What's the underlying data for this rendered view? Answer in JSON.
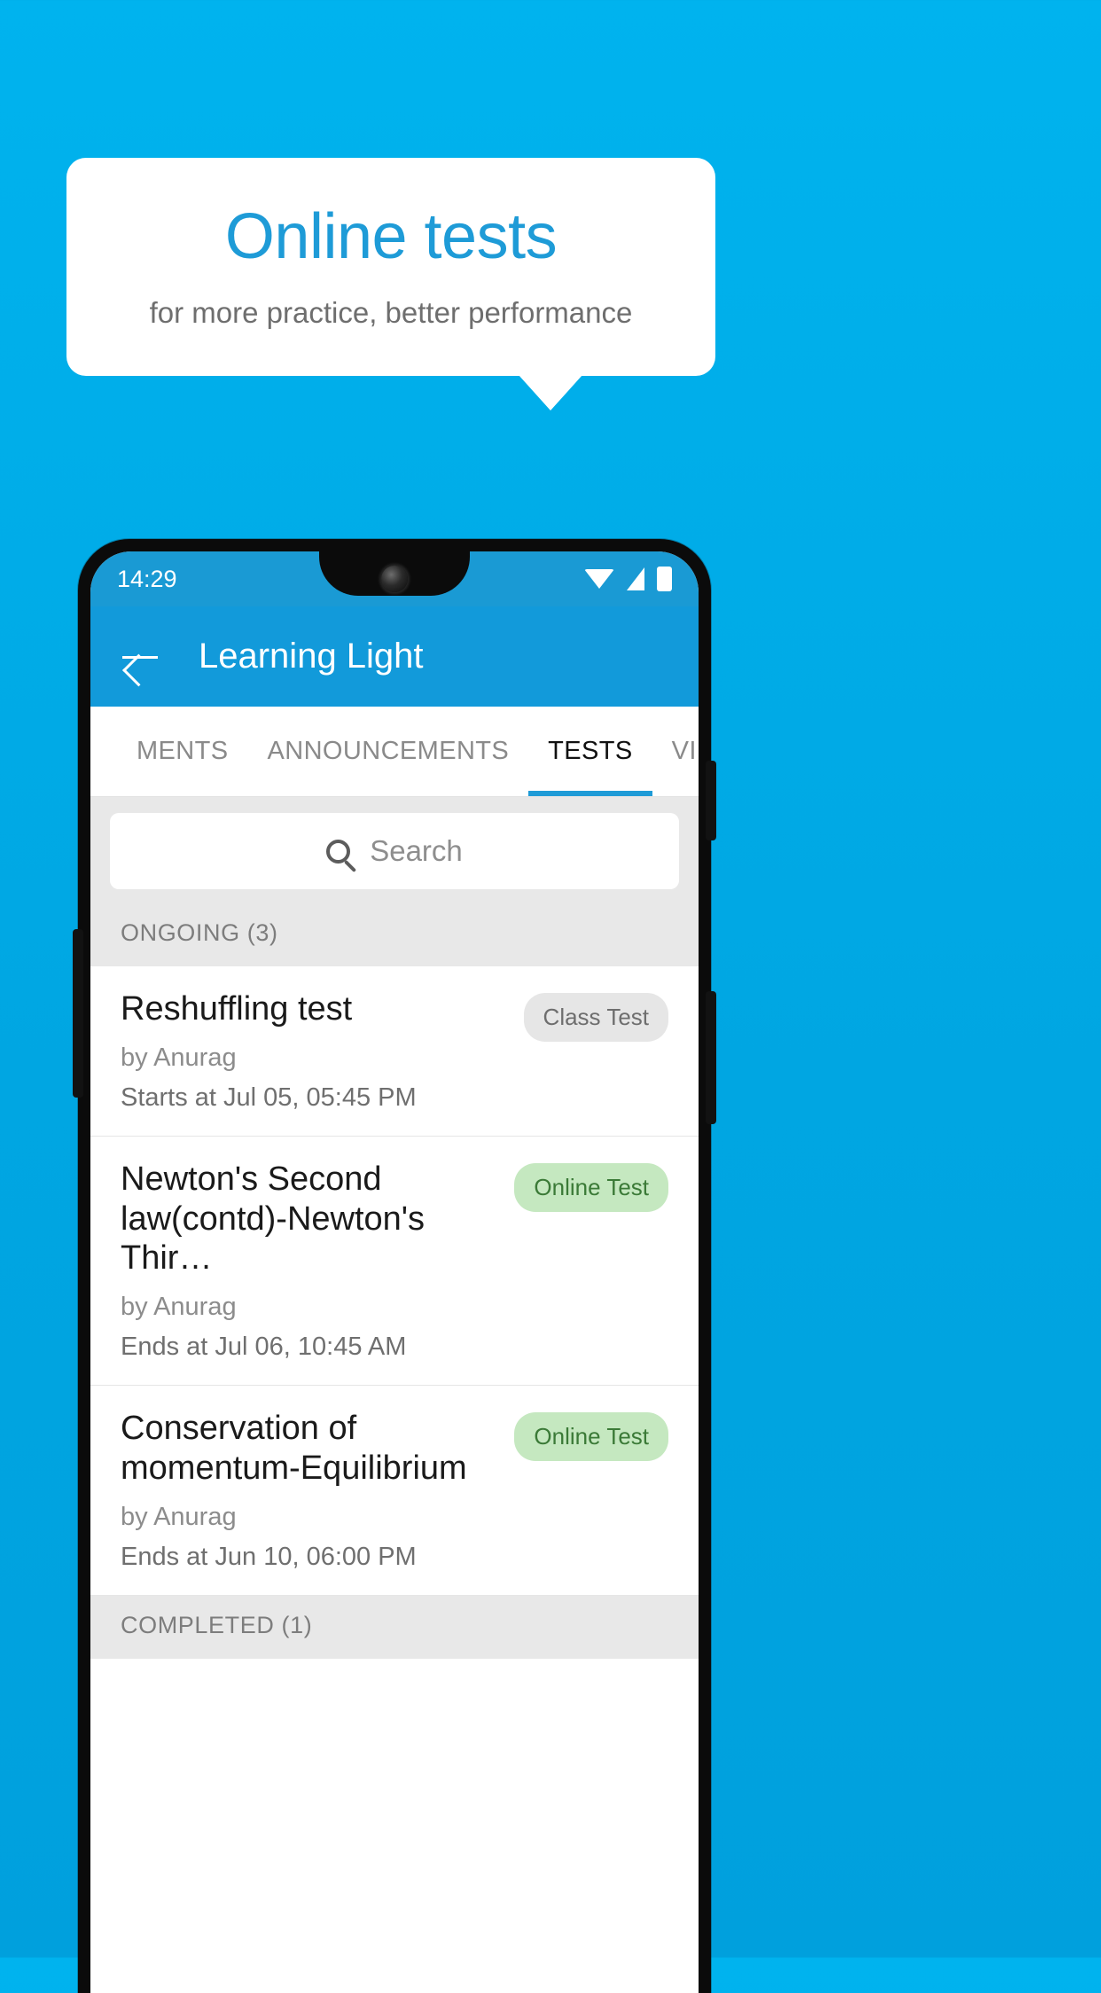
{
  "promo": {
    "title": "Online tests",
    "subtitle": "for more practice, better performance",
    "title_color": "#1e9bd7",
    "background_color": "#00ace4"
  },
  "phone": {
    "status_bar": {
      "time": "14:29",
      "icons": [
        "wifi-icon",
        "signal-icon",
        "battery-icon"
      ]
    },
    "app_bar": {
      "back_icon": "back-arrow-icon",
      "title": "Learning Light",
      "color": "#129ada"
    },
    "tabs": [
      {
        "label": "MENTS",
        "active": false
      },
      {
        "label": "ANNOUNCEMENTS",
        "active": false
      },
      {
        "label": "TESTS",
        "active": true
      },
      {
        "label": "VIDEOS",
        "active": false
      }
    ],
    "search": {
      "icon": "search-icon",
      "placeholder": "Search",
      "value": ""
    },
    "sections": [
      {
        "header": "ONGOING (3)",
        "rows": [
          {
            "title": "Reshuffling test",
            "author": "by Anurag",
            "schedule": "Starts at  Jul 05, 05:45 PM",
            "badge": "Class Test",
            "badge_style": "grey"
          },
          {
            "title": "Newton's Second law(contd)-Newton's Thir…",
            "author": "by Anurag",
            "schedule": "Ends at  Jul 06, 10:45 AM",
            "badge": "Online Test",
            "badge_style": "green"
          },
          {
            "title": "Conservation of momentum-Equilibrium",
            "author": "by Anurag",
            "schedule": "Ends at  Jun 10, 06:00 PM",
            "badge": "Online Test",
            "badge_style": "green"
          }
        ]
      },
      {
        "header": "COMPLETED (1)",
        "rows": []
      }
    ]
  }
}
